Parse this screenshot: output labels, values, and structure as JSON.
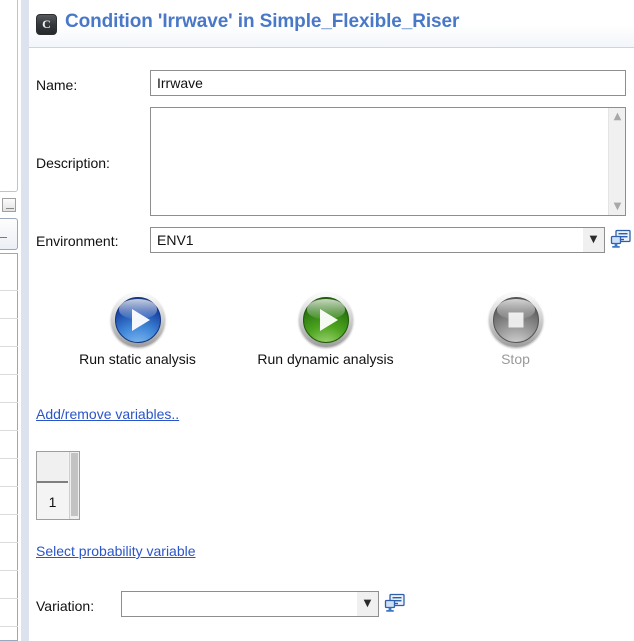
{
  "header": {
    "icon": "condition-c-icon",
    "title": "Condition 'Irrwave' in Simple_Flexible_Riser",
    "title_color": "#4a78c8"
  },
  "form": {
    "name": {
      "label": "Name:",
      "value": "Irrwave",
      "placeholder": ""
    },
    "description": {
      "label": "Description:",
      "value": "",
      "placeholder": ""
    },
    "environment": {
      "label": "Environment:",
      "value": "ENV1",
      "dropdown_arrow": "chevron-down-icon",
      "edit_icon": "edit-environment-icon"
    },
    "variation": {
      "label": "Variation:",
      "value": "",
      "dropdown_arrow": "chevron-down-icon",
      "edit_icon": "edit-variation-icon"
    }
  },
  "actions": [
    {
      "id": "run-static-analysis",
      "label": "Run static analysis",
      "icon": "play-icon",
      "color": "#2a6fd0",
      "enabled": true
    },
    {
      "id": "run-dynamic-analysis",
      "label": "Run dynamic analysis",
      "icon": "play-icon",
      "color": "#4ea520",
      "enabled": true
    },
    {
      "id": "stop",
      "label": "Stop",
      "icon": "stop-square-icon",
      "color": "#8a8a8a",
      "enabled": false
    }
  ],
  "links": {
    "add_remove_variables": "Add/remove variables..",
    "select_probability_variable": "Select probability variable"
  },
  "variables_grid": {
    "header_cell": "",
    "rows": [
      {
        "index": "1"
      }
    ]
  },
  "scrollbars": {
    "up_arrow": "chevron-up-icon",
    "down_arrow": "chevron-down-icon"
  }
}
